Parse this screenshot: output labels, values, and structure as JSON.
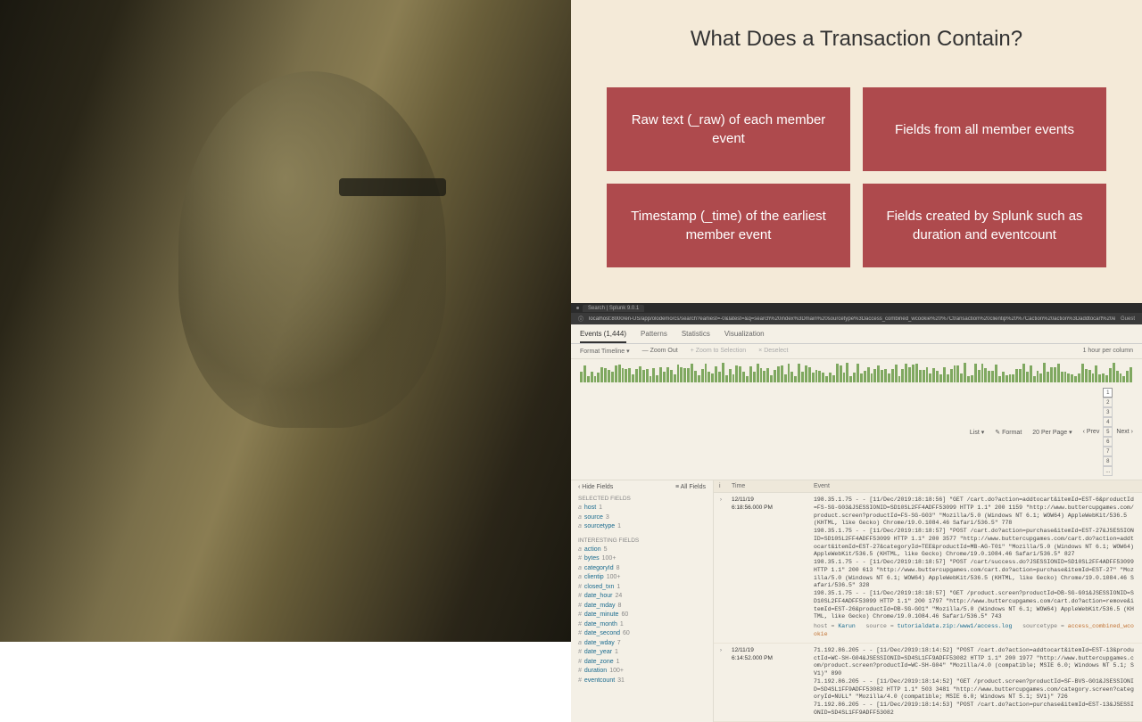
{
  "slide": {
    "title": "What Does a Transaction Contain?",
    "cards": [
      "Raw text (_raw) of each member event",
      "Fields from all member events",
      "Timestamp (_time) of the earliest member event",
      "Fields created by Splunk such as duration and eventcount"
    ]
  },
  "browser": {
    "tab_title": "Search | Splunk 9.0.1",
    "url": "localhost:8000/en-US/app/olodemo/cs/search?earliest=-0&latest=&q=search%20index%3Dmain%20sourcetype%3Daccess_combined_wcookie%20%7Ctransaction%20clientip%20%7Caction%20action%3Daddtocart%20endswith%3D...",
    "guest": "Guest"
  },
  "tabs": {
    "events": "Events (1,444)",
    "patterns": "Patterns",
    "statistics": "Statistics",
    "visualization": "Visualization"
  },
  "timeline_controls": {
    "format": "Format Timeline ▾",
    "zoom_out": "— Zoom Out",
    "zoom_sel": "+ Zoom to Selection",
    "deselect": "× Deselect",
    "note": "1 hour per column"
  },
  "list_controls": {
    "list": "List ▾",
    "format": "✎ Format",
    "per_page": "20 Per Page ▾",
    "prev": "‹ Prev",
    "pages": [
      "1",
      "2",
      "3",
      "4",
      "5",
      "6",
      "7",
      "8",
      "..."
    ],
    "next": "Next ›"
  },
  "fields": {
    "hide": "‹ Hide Fields",
    "all": "≡ All Fields",
    "selected_title": "Selected Fields",
    "selected": [
      {
        "pre": "a",
        "name": "host",
        "count": "1"
      },
      {
        "pre": "a",
        "name": "source",
        "count": "3"
      },
      {
        "pre": "a",
        "name": "sourcetype",
        "count": "1"
      }
    ],
    "interesting_title": "Interesting Fields",
    "interesting": [
      {
        "pre": "a",
        "name": "action",
        "count": "5"
      },
      {
        "pre": "#",
        "name": "bytes",
        "count": "100+"
      },
      {
        "pre": "a",
        "name": "categoryId",
        "count": "8"
      },
      {
        "pre": "a",
        "name": "clientip",
        "count": "100+"
      },
      {
        "pre": "#",
        "name": "closed_txn",
        "count": "1"
      },
      {
        "pre": "#",
        "name": "date_hour",
        "count": "24"
      },
      {
        "pre": "#",
        "name": "date_mday",
        "count": "8"
      },
      {
        "pre": "#",
        "name": "date_minute",
        "count": "60"
      },
      {
        "pre": "#",
        "name": "date_month",
        "count": "1"
      },
      {
        "pre": "#",
        "name": "date_second",
        "count": "60"
      },
      {
        "pre": "a",
        "name": "date_wday",
        "count": "7"
      },
      {
        "pre": "#",
        "name": "date_year",
        "count": "1"
      },
      {
        "pre": "#",
        "name": "date_zone",
        "count": "1"
      },
      {
        "pre": "#",
        "name": "duration",
        "count": "100+"
      },
      {
        "pre": "#",
        "name": "eventcount",
        "count": "31"
      }
    ]
  },
  "events_hdr": {
    "i": "i",
    "time": "Time",
    "event": "Event"
  },
  "events": [
    {
      "date": "12/11/19",
      "time": "6:18:56.000 PM",
      "raw": "198.35.1.75 - - [11/Dec/2019:18:18:56] \"GET /cart.do?action=addtocart&itemId=EST-6&productId=FS-SG-G03&JSESSIONID=SD10SL2FF4ADFF53099 HTTP 1.1\" 200 1159 \"http://www.buttercupgames.com/product.screen?productId=FS-SG-G03\" \"Mozilla/5.0 (Windows NT 6.1; WOW64) AppleWebKit/536.5 (KHTML, like Gecko) Chrome/19.0.1084.46 Safari/536.5\" 778\n198.35.1.75 - - [11/Dec/2019:18:18:57] \"POST /cart.do?action=purchase&itemId=EST-27&JSESSIONID=SD10SL2FF4ADFF53099 HTTP 1.1\" 200 3577 \"http://www.buttercupgames.com/cart.do?action=addtocart&itemId=EST-27&categoryId=TEE&productId=MB-AG-T01\" \"Mozilla/5.0 (Windows NT 6.1; WOW64) AppleWebKit/536.5 (KHTML, like Gecko) Chrome/19.0.1084.46 Safari/536.5\" 827\n198.35.1.75 - - [11/Dec/2019:18:18:57] \"POST /cart/success.do?JSESSIONID=SD10SL2FF4ADFF53099 HTTP 1.1\" 200 613 \"http://www.buttercupgames.com/cart.do?action=purchase&itemId=EST-27\" \"Mozilla/5.0 (Windows NT 6.1; WOW64) AppleWebKit/536.5 (KHTML, like Gecko) Chrome/19.0.1084.46 Safari/536.5\" 328\n198.35.1.75 - - [11/Dec/2019:18:18:57] \"GET /product.screen?productId=DB-SG-G01&JSESSIONID=SD10SL2FF4ADFF53099 HTTP 1.1\" 200 1797 \"http://www.buttercupgames.com/cart.do?action=remove&itemId=EST-26&productId=DB-SG-G01\" \"Mozilla/5.0 (Windows NT 6.1; WOW64) AppleWebKit/536.5 (KHTML, like Gecko) Chrome/19.0.1084.46 Safari/536.5\" 743",
      "host": "Karun",
      "source": "tutorialdata.zip:/www1/access.log",
      "sourcetype": "access_combined_wcookie"
    },
    {
      "date": "12/11/19",
      "time": "6:14:52.000 PM",
      "raw": "71.192.86.205 - - [11/Dec/2019:18:14:52] \"POST /cart.do?action=addtocart&itemId=EST-13&productId=WC-SH-G04&JSESSIONID=SD4SL1FF9ADFF53082 HTTP 1.1\" 200 1977 \"http://www.buttercupgames.com/product.screen?productId=WC-SH-G04\" \"Mozilla/4.0 (compatible; MSIE 6.0; Windows NT 5.1; SV1)\" 890\n71.192.86.205 - - [11/Dec/2019:18:14:52] \"GET /product.screen?productId=SF-BVS-G01&JSESSIONID=SD4SL1FF9ADFF53082 HTTP 1.1\" 503 3481 \"http://www.buttercupgames.com/category.screen?categoryId=NULL\" \"Mozilla/4.0 (compatible; MSIE 6.0; Windows NT 5.1; SV1)\" 726\n71.192.86.205 - - [11/Dec/2019:18:14:53] \"POST /cart.do?action=purchase&itemId=EST-13&JSESSIONID=SD4SL1FF9ADFF53082",
      "host": "",
      "source": "",
      "sourcetype": ""
    }
  ]
}
